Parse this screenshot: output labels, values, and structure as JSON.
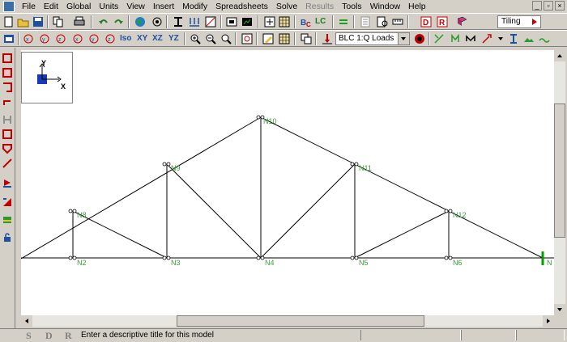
{
  "menu": {
    "items": [
      "File",
      "Edit",
      "Global",
      "Units",
      "View",
      "Insert",
      "Modify",
      "Spreadsheets",
      "Solve",
      "Results",
      "Tools",
      "Window",
      "Help"
    ],
    "disabled": [
      "Results"
    ]
  },
  "toolbar": {
    "lc_label": "LC",
    "tiling_label": "Tiling",
    "iso_label": "Iso",
    "xy_label": "XY",
    "xz_label": "XZ",
    "yz_label": "YZ",
    "load_combo_value": "BLC 1:Q Loads"
  },
  "axes": {
    "y_label": "Y",
    "x_label": "X"
  },
  "nodes": {
    "n2": "N2",
    "n3": "N3",
    "n4": "N4",
    "n5": "N5",
    "n6": "N6",
    "n7": "N",
    "n8": "N8",
    "n9": "N9",
    "n10": "N10",
    "n11": "N11",
    "n12": "N12"
  },
  "status": {
    "s": "S",
    "d": "D",
    "r": "R",
    "message": "Enter a descriptive title for this model"
  },
  "colors": {
    "node_label": "#3c9a3c",
    "member": "#000000",
    "support": "#00a000",
    "background": "#d4d0c8"
  }
}
